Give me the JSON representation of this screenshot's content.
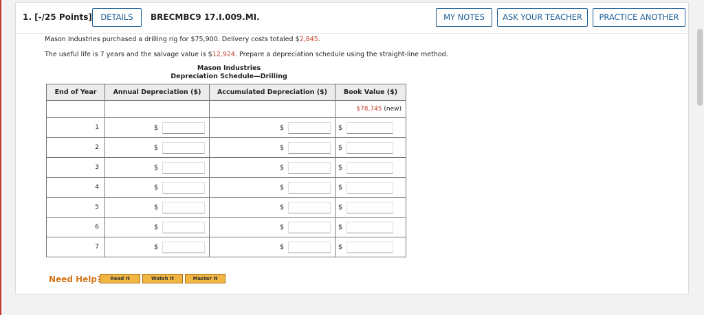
{
  "header": {
    "question_number": "1.",
    "points": "[-/25 Points]",
    "details_label": "DETAILS",
    "question_code": "BRECMBC9 17.I.009.MI.",
    "my_notes_label": "MY NOTES",
    "ask_teacher_label": "ASK YOUR TEACHER",
    "practice_label": "PRACTICE ANOTHER"
  },
  "problem": {
    "line1_a": "Mason Industries purchased a drilling rig for $75,900. Delivery costs totaled $",
    "line1_val": "2,845",
    "line1_b": ".",
    "line2_a": "The useful life is 7 years and the salvage value is $",
    "line2_val": "12,924",
    "line2_b": ". Prepare a depreciation schedule using the straight-line method."
  },
  "table": {
    "title1": "Mason Industries",
    "title2": "Depreciation Schedule—Drilling",
    "headers": [
      "End of Year",
      "Annual Depreciation ($)",
      "Accumulated Depreciation ($)",
      "Book Value ($)"
    ],
    "initial_book_value": "$78,745",
    "initial_book_note": "(new)",
    "currency": "$",
    "years": [
      "1",
      "2",
      "3",
      "4",
      "5",
      "6",
      "7"
    ]
  },
  "help": {
    "label": "Need Help?",
    "read_it": "Read It",
    "watch_it": "Watch It",
    "master_it": "Master It"
  },
  "colors": {
    "accent": "#1a5c96",
    "red": "#c0392b",
    "help_orange": "#d4761c",
    "help_btn": "#f0b542"
  }
}
